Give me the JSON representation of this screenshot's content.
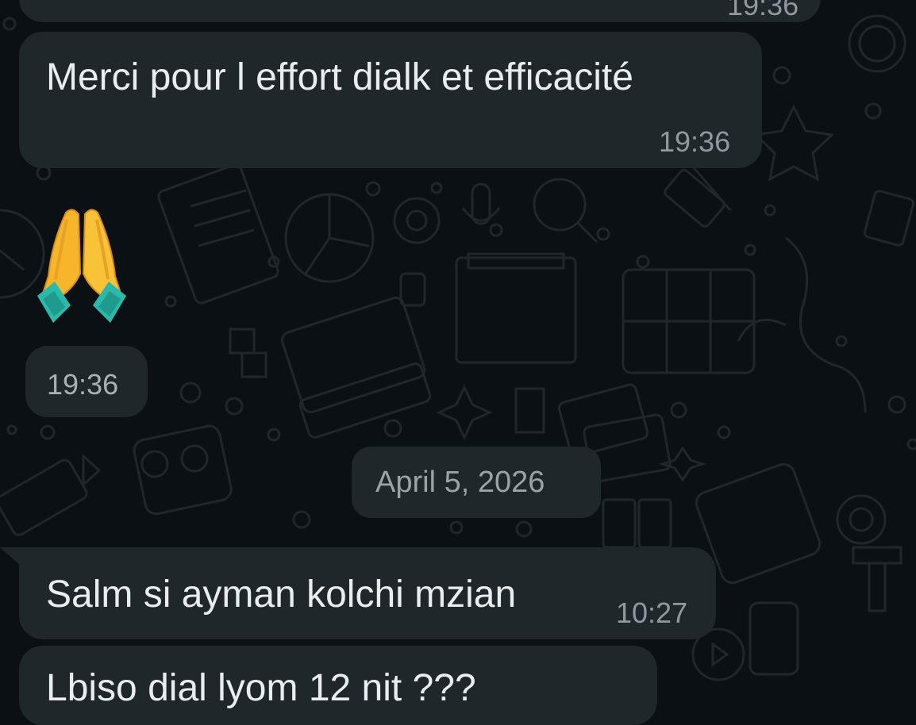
{
  "chat": {
    "prev_message": {
      "time": "19:36"
    },
    "message_merci": {
      "text": "Merci pour l effort dialk et efficacité",
      "time": "19:36"
    },
    "message_emoji": {
      "emoji_name": "folded-hands-icon",
      "time": "19:36"
    },
    "date_separator": "April 5, 2026",
    "message_salm": {
      "text": "Salm si ayman kolchi mzian",
      "time": "10:27"
    },
    "message_cut": {
      "text": "Lbiso dial lyom 12 nit ???"
    }
  },
  "colors": {
    "background": "#0b1014",
    "incoming_bubble": "#1f272a",
    "text": "#e9edef",
    "timestamp": "#8f9a9f"
  }
}
